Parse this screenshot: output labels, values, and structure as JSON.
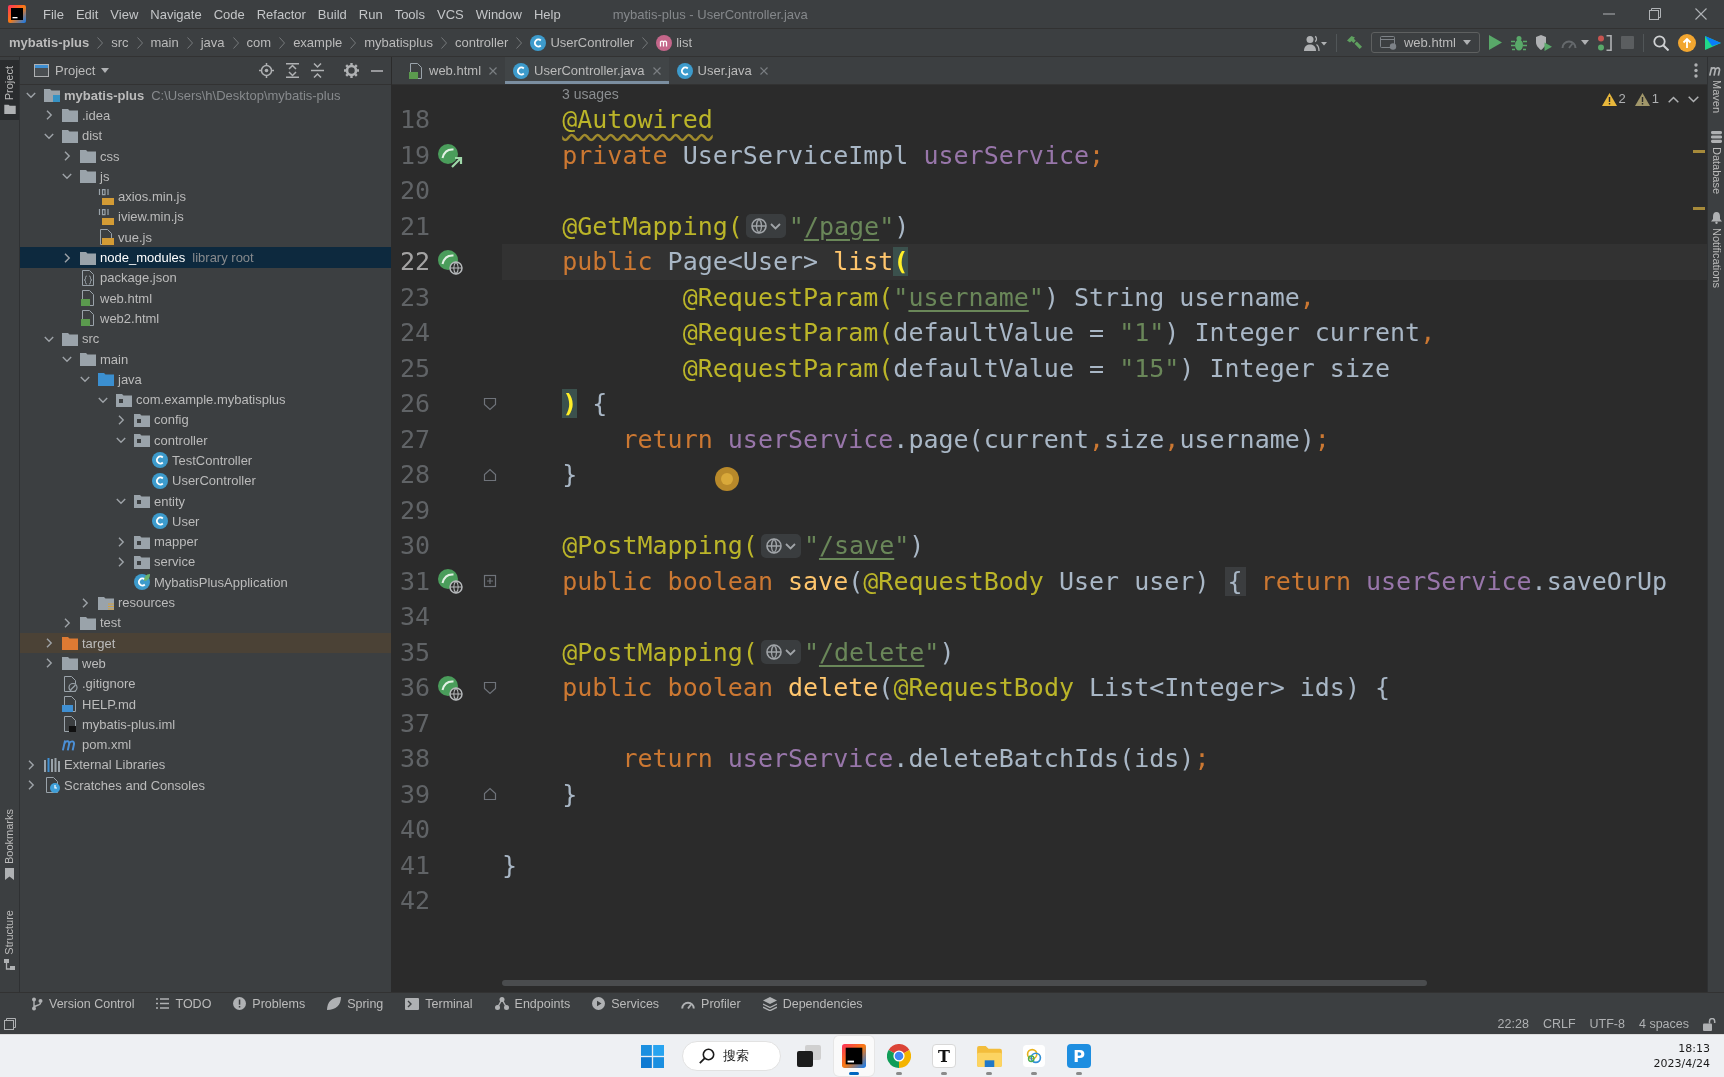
{
  "window": {
    "title": "mybatis-plus - UserController.java"
  },
  "menu": [
    "File",
    "Edit",
    "View",
    "Navigate",
    "Code",
    "Refactor",
    "Build",
    "Run",
    "Tools",
    "VCS",
    "Window",
    "Help"
  ],
  "breadcrumb": [
    {
      "label": "mybatis-plus",
      "kind": "project"
    },
    {
      "label": "src",
      "kind": "folder"
    },
    {
      "label": "main",
      "kind": "folder"
    },
    {
      "label": "java",
      "kind": "folder"
    },
    {
      "label": "com",
      "kind": "folder"
    },
    {
      "label": "example",
      "kind": "folder"
    },
    {
      "label": "mybatisplus",
      "kind": "folder"
    },
    {
      "label": "controller",
      "kind": "folder"
    },
    {
      "label": "UserController",
      "kind": "class"
    },
    {
      "label": "list",
      "kind": "method"
    }
  ],
  "toolbar": {
    "run_config": "web.html"
  },
  "left_strip": {
    "top": [
      {
        "label": "Project",
        "kind": "project",
        "selected": true
      }
    ],
    "bottom": [
      {
        "label": "Bookmarks",
        "kind": "bookmarks",
        "selected": false
      },
      {
        "label": "Structure",
        "kind": "structure",
        "selected": false
      }
    ]
  },
  "project_panel": {
    "title": "Project",
    "tree": [
      {
        "label": "mybatis-plus",
        "kind": "project_root",
        "hint": "C:\\Users\\h\\Desktop\\mybatis-plus",
        "selected": false,
        "expanded": true,
        "children": [
          {
            "label": ".idea",
            "kind": "folder",
            "selected": false,
            "expanded": false
          },
          {
            "label": "dist",
            "kind": "folder",
            "selected": false,
            "expanded": true,
            "children": [
              {
                "label": "css",
                "kind": "folder",
                "selected": false,
                "expanded": false
              },
              {
                "label": "js",
                "kind": "folder",
                "selected": false,
                "expanded": true,
                "children": [
                  {
                    "label": "axios.min.js",
                    "kind": "min_js",
                    "selected": false
                  },
                  {
                    "label": "iview.min.js",
                    "kind": "min_js",
                    "selected": false
                  },
                  {
                    "label": "vue.js",
                    "kind": "js",
                    "selected": false
                  }
                ]
              },
              {
                "label": "node_modules",
                "kind": "folder",
                "hint": "library root",
                "selected": true,
                "expanded": false
              },
              {
                "label": "package.json",
                "kind": "json",
                "selected": false
              },
              {
                "label": "web.html",
                "kind": "html",
                "selected": false
              },
              {
                "label": "web2.html",
                "kind": "html",
                "selected": false
              }
            ]
          },
          {
            "label": "src",
            "kind": "folder",
            "selected": false,
            "expanded": true,
            "children": [
              {
                "label": "main",
                "kind": "folder",
                "selected": false,
                "expanded": true,
                "children": [
                  {
                    "label": "java",
                    "kind": "source_root",
                    "selected": false,
                    "expanded": true,
                    "children": [
                      {
                        "label": "com.example.mybatisplus",
                        "kind": "package",
                        "selected": false,
                        "expanded": true,
                        "children": [
                          {
                            "label": "config",
                            "kind": "package",
                            "selected": false,
                            "expanded": false
                          },
                          {
                            "label": "controller",
                            "kind": "package",
                            "selected": false,
                            "expanded": true,
                            "children": [
                              {
                                "label": "TestController",
                                "kind": "class",
                                "selected": false
                              },
                              {
                                "label": "UserController",
                                "kind": "class",
                                "selected": false
                              }
                            ]
                          },
                          {
                            "label": "entity",
                            "kind": "package",
                            "selected": false,
                            "expanded": true,
                            "children": [
                              {
                                "label": "User",
                                "kind": "class",
                                "selected": false
                              }
                            ]
                          },
                          {
                            "label": "mapper",
                            "kind": "package",
                            "selected": false,
                            "expanded": false
                          },
                          {
                            "label": "service",
                            "kind": "package",
                            "selected": false,
                            "expanded": false
                          },
                          {
                            "label": "MybatisPlusApplication",
                            "kind": "spring_class",
                            "selected": false
                          }
                        ]
                      }
                    ]
                  },
                  {
                    "label": "resources",
                    "kind": "resources_root",
                    "selected": false,
                    "expanded": false
                  }
                ]
              },
              {
                "label": "test",
                "kind": "folder",
                "selected": false,
                "expanded": false
              }
            ]
          },
          {
            "label": "target",
            "kind": "excluded_folder",
            "selected": false,
            "expanded": false
          },
          {
            "label": "web",
            "kind": "folder",
            "selected": false,
            "expanded": false
          },
          {
            "label": ".gitignore",
            "kind": "gitignore",
            "selected": false
          },
          {
            "label": "HELP.md",
            "kind": "markdown",
            "selected": false
          },
          {
            "label": "mybatis-plus.iml",
            "kind": "iml",
            "selected": false
          },
          {
            "label": "pom.xml",
            "kind": "maven",
            "selected": false
          }
        ]
      },
      {
        "label": "External Libraries",
        "kind": "libraries",
        "selected": false,
        "expanded": false
      },
      {
        "label": "Scratches and Consoles",
        "kind": "scratches",
        "selected": false,
        "expanded": false
      }
    ]
  },
  "editor_tabs": [
    {
      "label": "web.html",
      "kind": "html",
      "selected": false
    },
    {
      "label": "UserController.java",
      "kind": "class",
      "selected": true
    },
    {
      "label": "User.java",
      "kind": "class",
      "selected": false
    }
  ],
  "inspections": {
    "warnings": "2",
    "weak_warnings": "1"
  },
  "editor": {
    "usages_hint": "3 usages",
    "lines": [
      {
        "number": "18",
        "current": false,
        "tokens": [
          {
            "text": "    @Autowired",
            "kind": "annotation_warning"
          }
        ]
      },
      {
        "number": "19",
        "current": false,
        "gutter": [
          {
            "kind": "bean_navigate"
          }
        ],
        "tokens": [
          {
            "text": "    private ",
            "kind": "keyword"
          },
          {
            "text": "UserServiceImpl ",
            "kind": "plain"
          },
          {
            "text": "userService",
            "kind": "field"
          },
          {
            "text": ";",
            "kind": "punct"
          }
        ]
      },
      {
        "number": "20",
        "current": false
      },
      {
        "number": "21",
        "current": false,
        "tokens": [
          {
            "text": "    @GetMapping(",
            "kind": "annotation"
          },
          {
            "kind": "endpoint_inlay"
          },
          {
            "text": "\"",
            "kind": "string"
          },
          {
            "text": "/page",
            "kind": "string_link"
          },
          {
            "text": "\"",
            "kind": "string"
          },
          {
            "text": ")",
            "kind": "plain"
          }
        ]
      },
      {
        "number": "22",
        "current": true,
        "gutter": [
          {
            "kind": "bean_endpoint"
          }
        ],
        "tokens": [
          {
            "text": "    public ",
            "kind": "keyword"
          },
          {
            "text": "Page<User> ",
            "kind": "plain"
          },
          {
            "text": "list",
            "kind": "method_decl"
          },
          {
            "text": "(",
            "kind": "brace_match"
          }
        ]
      },
      {
        "number": "23",
        "current": false,
        "tokens": [
          {
            "text": "            @RequestParam(",
            "kind": "annotation"
          },
          {
            "text": "\"",
            "kind": "string"
          },
          {
            "text": "username",
            "kind": "string_link"
          },
          {
            "text": "\"",
            "kind": "string"
          },
          {
            "text": ") String username",
            "kind": "plain"
          },
          {
            "text": ",",
            "kind": "punct"
          }
        ]
      },
      {
        "number": "24",
        "current": false,
        "tokens": [
          {
            "text": "            @RequestParam(",
            "kind": "annotation"
          },
          {
            "text": "defaultValue = ",
            "kind": "plain"
          },
          {
            "text": "\"1\"",
            "kind": "string"
          },
          {
            "text": ") Integer current",
            "kind": "plain"
          },
          {
            "text": ",",
            "kind": "punct"
          }
        ]
      },
      {
        "number": "25",
        "current": false,
        "tokens": [
          {
            "text": "            @RequestParam(",
            "kind": "annotation"
          },
          {
            "text": "defaultValue = ",
            "kind": "plain"
          },
          {
            "text": "\"15\"",
            "kind": "string"
          },
          {
            "text": ") Integer size",
            "kind": "plain"
          }
        ]
      },
      {
        "number": "26",
        "current": false,
        "gutter": [
          {
            "kind": "fold_start"
          }
        ],
        "tokens": [
          {
            "text": "    )",
            "kind": "brace_match"
          },
          {
            "text": " {",
            "kind": "plain"
          }
        ]
      },
      {
        "number": "27",
        "current": false,
        "tokens": [
          {
            "text": "        return ",
            "kind": "keyword"
          },
          {
            "text": "userService",
            "kind": "field"
          },
          {
            "text": ".page(current",
            "kind": "plain"
          },
          {
            "text": ",",
            "kind": "punct"
          },
          {
            "text": "size",
            "kind": "plain"
          },
          {
            "text": ",",
            "kind": "punct"
          },
          {
            "text": "username)",
            "kind": "plain"
          },
          {
            "text": ";",
            "kind": "punct"
          }
        ]
      },
      {
        "number": "28",
        "current": false,
        "gutter": [
          {
            "kind": "fold_end"
          }
        ],
        "tokens": [
          {
            "text": "    }",
            "kind": "plain"
          }
        ]
      },
      {
        "number": "29",
        "current": false
      },
      {
        "number": "30",
        "current": false,
        "tokens": [
          {
            "text": "    @PostMapping(",
            "kind": "annotation"
          },
          {
            "kind": "endpoint_inlay"
          },
          {
            "text": "\"",
            "kind": "string"
          },
          {
            "text": "/save",
            "kind": "string_link"
          },
          {
            "text": "\"",
            "kind": "string"
          },
          {
            "text": ")",
            "kind": "plain"
          }
        ]
      },
      {
        "number": "31",
        "current": false,
        "gutter": [
          {
            "kind": "bean_endpoint"
          },
          {
            "kind": "fold_collapsed"
          }
        ],
        "tokens": [
          {
            "text": "    public boolean ",
            "kind": "keyword"
          },
          {
            "text": "save",
            "kind": "method_decl"
          },
          {
            "text": "(",
            "kind": "plain"
          },
          {
            "text": "@RequestBody",
            "kind": "annotation"
          },
          {
            "text": " User user) ",
            "kind": "plain"
          },
          {
            "text": "{",
            "kind": "fold_placeholder"
          },
          {
            "text": " return ",
            "kind": "keyword"
          },
          {
            "text": "userService",
            "kind": "field"
          },
          {
            "text": ".saveOrUp",
            "kind": "plain"
          }
        ]
      },
      {
        "number": "34",
        "current": false
      },
      {
        "number": "35",
        "current": false,
        "tokens": [
          {
            "text": "    @PostMapping(",
            "kind": "annotation"
          },
          {
            "kind": "endpoint_inlay"
          },
          {
            "text": "\"",
            "kind": "string"
          },
          {
            "text": "/delete",
            "kind": "string_link"
          },
          {
            "text": "\"",
            "kind": "string"
          },
          {
            "text": ")",
            "kind": "plain"
          }
        ]
      },
      {
        "number": "36",
        "current": false,
        "gutter": [
          {
            "kind": "bean_endpoint"
          },
          {
            "kind": "fold_start"
          }
        ],
        "tokens": [
          {
            "text": "    public boolean ",
            "kind": "keyword"
          },
          {
            "text": "delete",
            "kind": "method_decl"
          },
          {
            "text": "(",
            "kind": "plain"
          },
          {
            "text": "@RequestBody",
            "kind": "annotation"
          },
          {
            "text": " List<Integer> ids) {",
            "kind": "plain"
          }
        ]
      },
      {
        "number": "37",
        "current": false
      },
      {
        "number": "38",
        "current": false,
        "tokens": [
          {
            "text": "        return ",
            "kind": "keyword"
          },
          {
            "text": "userService",
            "kind": "field"
          },
          {
            "text": ".deleteBatchIds(ids)",
            "kind": "plain"
          },
          {
            "text": ";",
            "kind": "punct"
          }
        ]
      },
      {
        "number": "39",
        "current": false,
        "gutter": [
          {
            "kind": "fold_end"
          }
        ],
        "tokens": [
          {
            "text": "    }",
            "kind": "plain"
          }
        ]
      },
      {
        "number": "40",
        "current": false
      },
      {
        "number": "41",
        "current": false,
        "tokens": [
          {
            "text": "}",
            "kind": "plain"
          }
        ]
      },
      {
        "number": "42",
        "current": false
      }
    ]
  },
  "right_strip": [
    {
      "label": "Maven",
      "kind": "maven",
      "selected": false
    },
    {
      "label": "Database",
      "kind": "database",
      "selected": false
    },
    {
      "label": "Notifications",
      "kind": "notifications",
      "selected": false
    }
  ],
  "bottom_tools": [
    {
      "label": "Version Control",
      "kind": "vcs",
      "selected": false
    },
    {
      "label": "TODO",
      "kind": "todo",
      "selected": false
    },
    {
      "label": "Problems",
      "kind": "problems",
      "selected": false
    },
    {
      "label": "Spring",
      "kind": "spring",
      "selected": false
    },
    {
      "label": "Terminal",
      "kind": "terminal",
      "selected": false
    },
    {
      "label": "Endpoints",
      "kind": "endpoints",
      "selected": false
    },
    {
      "label": "Services",
      "kind": "services",
      "selected": false
    },
    {
      "label": "Profiler",
      "kind": "profiler",
      "selected": false
    },
    {
      "label": "Dependencies",
      "kind": "dependencies",
      "selected": false
    }
  ],
  "status_bar": {
    "caret": "22:28",
    "line_separator": "CRLF",
    "encoding": "UTF-8",
    "indent": "4 spaces",
    "read_only": false
  },
  "taskbar": {
    "apps": [
      {
        "kind": "start"
      },
      {
        "kind": "search",
        "label": "搜索"
      },
      {
        "kind": "task_view"
      },
      {
        "kind": "intellij",
        "selected": true,
        "running": true
      },
      {
        "kind": "chrome",
        "selected": false,
        "running": true
      },
      {
        "kind": "letter_light",
        "glyph": "T",
        "selected": false,
        "running": true
      },
      {
        "kind": "explorer",
        "selected": false,
        "running": true
      },
      {
        "kind": "rings",
        "selected": false,
        "running": true
      },
      {
        "kind": "letter_blue",
        "glyph": "P",
        "selected": false,
        "running": true
      }
    ],
    "time": "18:13",
    "date": "2023/4/24"
  }
}
